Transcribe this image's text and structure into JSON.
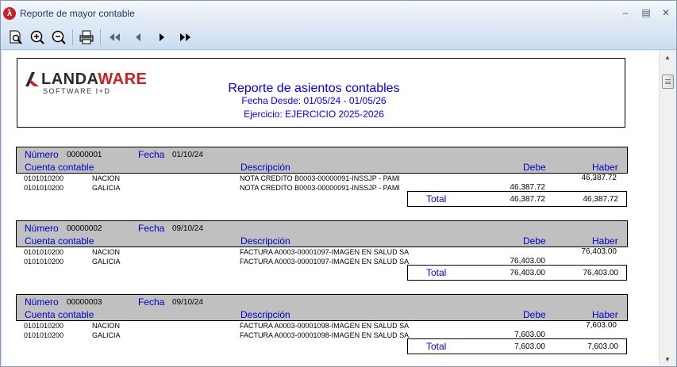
{
  "window": {
    "title": "Reporte de mayor contable",
    "icons": {
      "app": "app-icon",
      "minimize": "minimize-icon",
      "maximize": "maximize-icon",
      "close": "close-icon"
    }
  },
  "toolbar": {
    "buttons": [
      "page-view-icon",
      "zoom-in-icon",
      "zoom-out-icon",
      "print-icon",
      "first-page-icon",
      "previous-page-icon",
      "next-page-icon",
      "last-page-icon"
    ]
  },
  "report": {
    "logo": {
      "brand_part1": "LANDA",
      "brand_part2": "WARE",
      "subtitle": "SOFTWARE I+D"
    },
    "title": "Reporte de asientos contables",
    "date_range": "Fecha Desde: 01/05/24 - 01/05/26",
    "exercise": "Ejercicio: EJERCICIO 2025-2026",
    "labels": {
      "numero": "Número",
      "fecha": "Fecha",
      "cuenta": "Cuenta contable",
      "descripcion": "Descripción",
      "debe": "Debe",
      "haber": "Haber",
      "total": "Total"
    },
    "entries": [
      {
        "numero": "00000001",
        "fecha": "01/10/24",
        "rows": [
          {
            "cuenta": "0101010200",
            "nombre": "NACION",
            "descripcion": "NOTA CREDITO B0003-00000091-INSSJP - PAMI",
            "debe": "",
            "haber": "46,387.72"
          },
          {
            "cuenta": "0101010200",
            "nombre": "GALICIA",
            "descripcion": "NOTA CREDITO B0003-00000091-INSSJP - PAMI",
            "debe": "46,387.72",
            "haber": ""
          }
        ],
        "total_debe": "46,387.72",
        "total_haber": "46,387.72"
      },
      {
        "numero": "00000002",
        "fecha": "09/10/24",
        "rows": [
          {
            "cuenta": "0101010200",
            "nombre": "NACION",
            "descripcion": "FACTURA A0003-00001097-IMAGEN EN SALUD SA",
            "debe": "",
            "haber": "76,403.00"
          },
          {
            "cuenta": "0101010200",
            "nombre": "GALICIA",
            "descripcion": "FACTURA A0003-00001097-IMAGEN EN SALUD SA",
            "debe": "76,403.00",
            "haber": ""
          }
        ],
        "total_debe": "76,403.00",
        "total_haber": "76,403.00"
      },
      {
        "numero": "00000003",
        "fecha": "09/10/24",
        "rows": [
          {
            "cuenta": "0101010200",
            "nombre": "NACION",
            "descripcion": "FACTURA A0003-00001098-IMAGEN EN SALUD SA",
            "debe": "",
            "haber": "7,603.00"
          },
          {
            "cuenta": "0101010200",
            "nombre": "GALICIA",
            "descripcion": "FACTURA A0003-00001098-IMAGEN EN SALUD SA",
            "debe": "7,603.00",
            "haber": ""
          }
        ],
        "total_debe": "7,603.00",
        "total_haber": "7,603.00"
      }
    ]
  }
}
